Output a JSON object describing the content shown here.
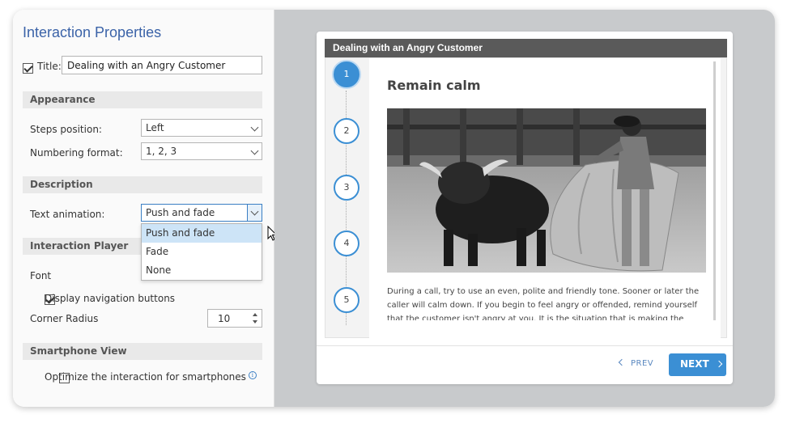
{
  "panel": {
    "title": "Interaction Properties",
    "title_checkbox_checked": true,
    "title_label": "Title:",
    "title_value": "Dealing with an Angry Customer",
    "sections": {
      "appearance": "Appearance",
      "description": "Description",
      "player": "Interaction Player",
      "smartphone": "Smartphone View"
    },
    "steps_position_label": "Steps position:",
    "steps_position_value": "Left",
    "numbering_format_label": "Numbering format:",
    "numbering_format_value": "1, 2, 3",
    "text_animation_label": "Text animation:",
    "text_animation_value": "Push and fade",
    "text_animation_options": [
      "Push and fade",
      "Fade",
      "None"
    ],
    "font_label": "Font",
    "display_nav_label": "Display navigation buttons",
    "display_nav_checked": true,
    "corner_radius_label": "Corner Radius",
    "corner_radius_value": "10",
    "optimize_label": "Optimize the interaction for smartphones",
    "optimize_checked": false
  },
  "preview": {
    "header": "Dealing with an Angry Customer",
    "steps": [
      "1",
      "2",
      "3",
      "4",
      "5"
    ],
    "active_step": "1",
    "content_title": "Remain calm",
    "content_text": "During a call, try to use an even, polite and friendly tone. Sooner or later the caller will calm down. If you begin to feel angry or offended, remind yourself that the customer isn't angry at you. It is the situation that is making the caller angry.",
    "prev_label": "PREV",
    "next_label": "NEXT",
    "accent_color": "#3b8fd4"
  }
}
